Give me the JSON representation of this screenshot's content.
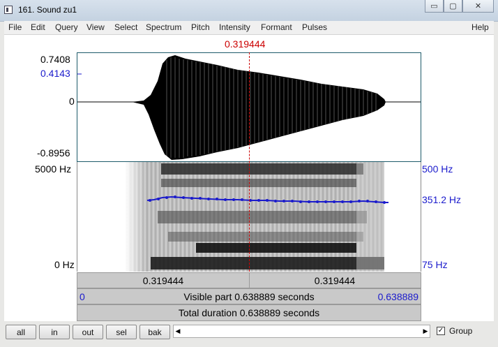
{
  "window": {
    "title": "161. Sound zu1",
    "minimize": "▭",
    "maximize": "▢",
    "close": "✕"
  },
  "menu": [
    "File",
    "Edit",
    "Query",
    "View",
    "Select",
    "Spectrum",
    "Pitch",
    "Intensity",
    "Formant",
    "Pulses"
  ],
  "help": "Help",
  "cursor": {
    "time": "0.319444"
  },
  "waveform": {
    "max_label": "0.7408",
    "cursor_value": "0.4143",
    "zero_label": "0",
    "min_label": "-0.8956"
  },
  "spectrogram": {
    "top_freq": "5000 Hz",
    "bottom_freq": "0 Hz",
    "pitch_top": "500 Hz",
    "pitch_value": "351.2 Hz",
    "pitch_bottom": "75 Hz"
  },
  "time_bars": {
    "left_part": "0.319444",
    "right_part": "0.319444",
    "visible_start": "0",
    "visible_text": "Visible part 0.638889 seconds",
    "visible_end": "0.638889",
    "total_text": "Total duration 0.638889 seconds"
  },
  "controls": {
    "all": "all",
    "in": "in",
    "out": "out",
    "sel": "sel",
    "bak": "bak",
    "scroll_left": "◀",
    "scroll_right": "▶",
    "group_checked": true,
    "group_label": "Group"
  },
  "colors": {
    "cursor": "#cc0000",
    "pitch": "#1a1acc",
    "waveform": "#000000"
  }
}
